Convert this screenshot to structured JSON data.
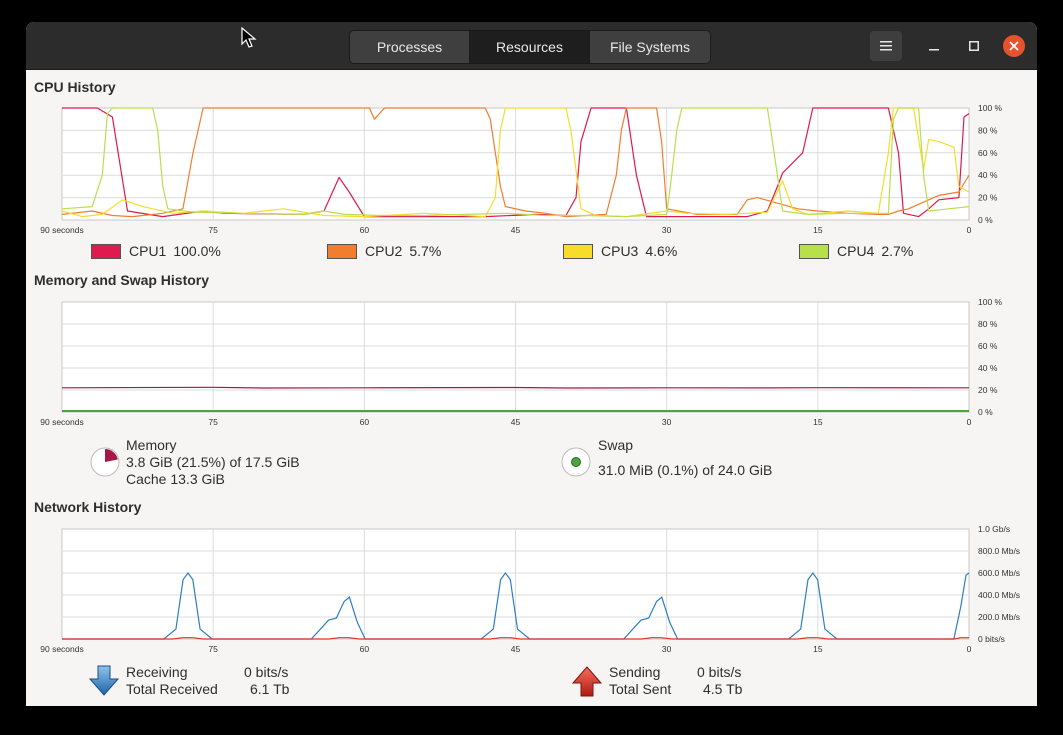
{
  "header": {
    "tabs": [
      {
        "label": "Processes",
        "active": false
      },
      {
        "label": "Resources",
        "active": true
      },
      {
        "label": "File Systems",
        "active": false
      }
    ],
    "menu_icon": "hamburger-menu-icon",
    "close_color": "#e5532d"
  },
  "cpu": {
    "title": "CPU History",
    "y_ticks": [
      "100 %",
      "80 %",
      "60 %",
      "40 %",
      "20 %",
      "0 %"
    ],
    "x_ticks": [
      "90 seconds",
      "75",
      "60",
      "45",
      "30",
      "15",
      "0"
    ],
    "legend": [
      {
        "label": "CPU1",
        "value": "100.0%",
        "color": "#e0194e"
      },
      {
        "label": "CPU2",
        "value": "5.7%",
        "color": "#f27d2e"
      },
      {
        "label": "CPU3",
        "value": "4.6%",
        "color": "#f8dc2a"
      },
      {
        "label": "CPU4",
        "value": "2.7%",
        "color": "#b8e04a"
      }
    ]
  },
  "memory": {
    "title": "Memory and Swap History",
    "y_ticks": [
      "100 %",
      "80 %",
      "60 %",
      "40 %",
      "20 %",
      "0 %"
    ],
    "x_ticks": [
      "90 seconds",
      "75",
      "60",
      "45",
      "30",
      "15",
      "0"
    ],
    "memory_label": "Memory",
    "memory_used": "3.8 GiB (21.5%) of 17.5 GiB",
    "memory_cache": "Cache 13.3 GiB",
    "memory_fraction": 0.215,
    "memory_color": "#a6184a",
    "swap_label": "Swap",
    "swap_used": "31.0 MiB (0.1%) of 24.0 GiB",
    "swap_fraction": 0.001,
    "swap_color": "#4ea33c"
  },
  "network": {
    "title": "Network History",
    "y_ticks": [
      "1.0 Gb/s",
      "800.0 Mb/s",
      "600.0 Mb/s",
      "400.0 Mb/s",
      "200.0 Mb/s",
      "0 bits/s"
    ],
    "x_ticks": [
      "90 seconds",
      "75",
      "60",
      "45",
      "30",
      "15",
      "0"
    ],
    "receiving_label": "Receiving",
    "receiving_value": "0 bits/s",
    "total_received_label": "Total Received",
    "total_received_value": "6.1 Tb",
    "sending_label": "Sending",
    "sending_value": "0 bits/s",
    "total_sent_label": "Total Sent",
    "total_sent_value": "4.5 Tb",
    "receive_color": "#2d7fc1",
    "send_color": "#e0362a"
  }
}
